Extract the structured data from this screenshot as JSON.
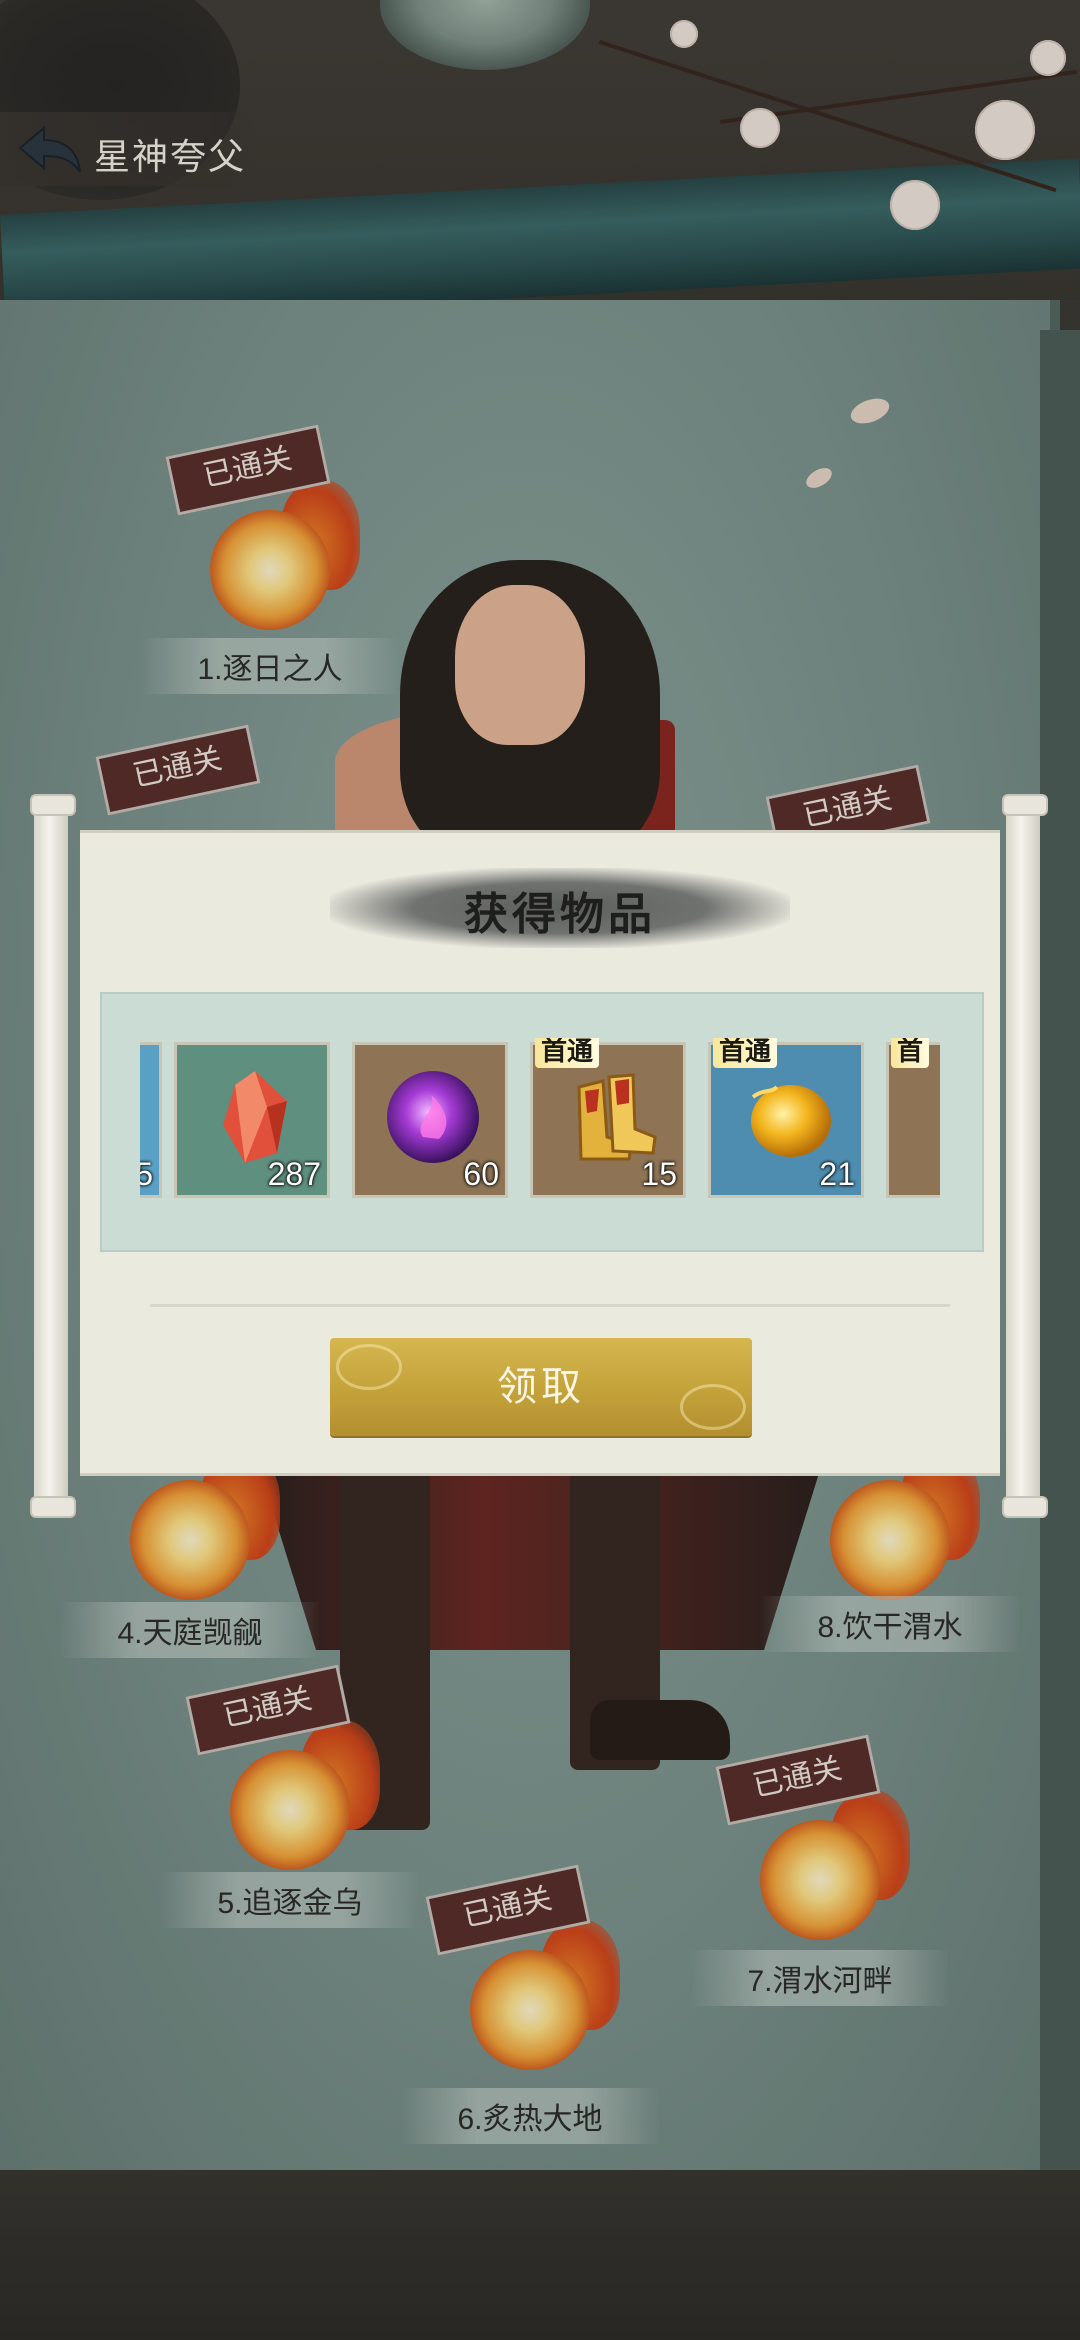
{
  "header": {
    "title": "星神夸父"
  },
  "stages": [
    {
      "label": "1.逐日之人",
      "stamp": "已通关"
    },
    {
      "label": "4.天庭觊觎",
      "stamp": "已通关"
    },
    {
      "label": "5.追逐金乌",
      "stamp": "已通关"
    },
    {
      "label": "6.炙热大地",
      "stamp": "已通关"
    },
    {
      "label": "7.渭水河畔",
      "stamp": "已通关"
    },
    {
      "label": "8.饮干渭水",
      "stamp": "已通关"
    },
    {
      "stamp": "已通关"
    },
    {
      "stamp": "已通关"
    }
  ],
  "dialog": {
    "title": "获得物品",
    "claim_label": "领取",
    "items": [
      {
        "count": "5",
        "bg": "#5aa0c4",
        "art": "partial-item"
      },
      {
        "count": "287",
        "bg": "#5f8f7e",
        "art": "red-crystal"
      },
      {
        "count": "60",
        "bg": "#8e7354",
        "art": "purple-orb"
      },
      {
        "count": "15",
        "bg": "#8e7354",
        "art": "golden-boots",
        "badge": "首通"
      },
      {
        "count": "21",
        "bg": "#4e8db0",
        "art": "gold-ingot",
        "badge": "首通"
      },
      {
        "bg": "#8e7354",
        "art": "partial-item",
        "badge": "首"
      }
    ]
  },
  "colors": {
    "claim_button": "#c4a23a",
    "stamp": "#5a2f2c",
    "item_panel": "#cbdcd4"
  }
}
